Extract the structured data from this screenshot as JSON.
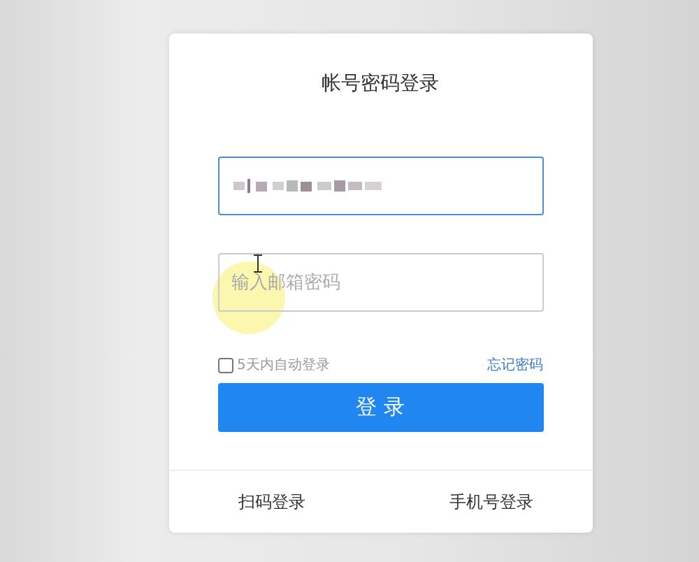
{
  "title": "帐号密码登录",
  "username": {
    "focused": true
  },
  "password": {
    "placeholder": "输入邮箱密码",
    "focused": false
  },
  "remember": {
    "label": "5天内自动登录",
    "checked": false
  },
  "forgot_link": "忘记密码",
  "submit_button": "登 录",
  "footer": [
    {
      "label": "扫码登录"
    },
    {
      "label": "手机号登录"
    }
  ]
}
